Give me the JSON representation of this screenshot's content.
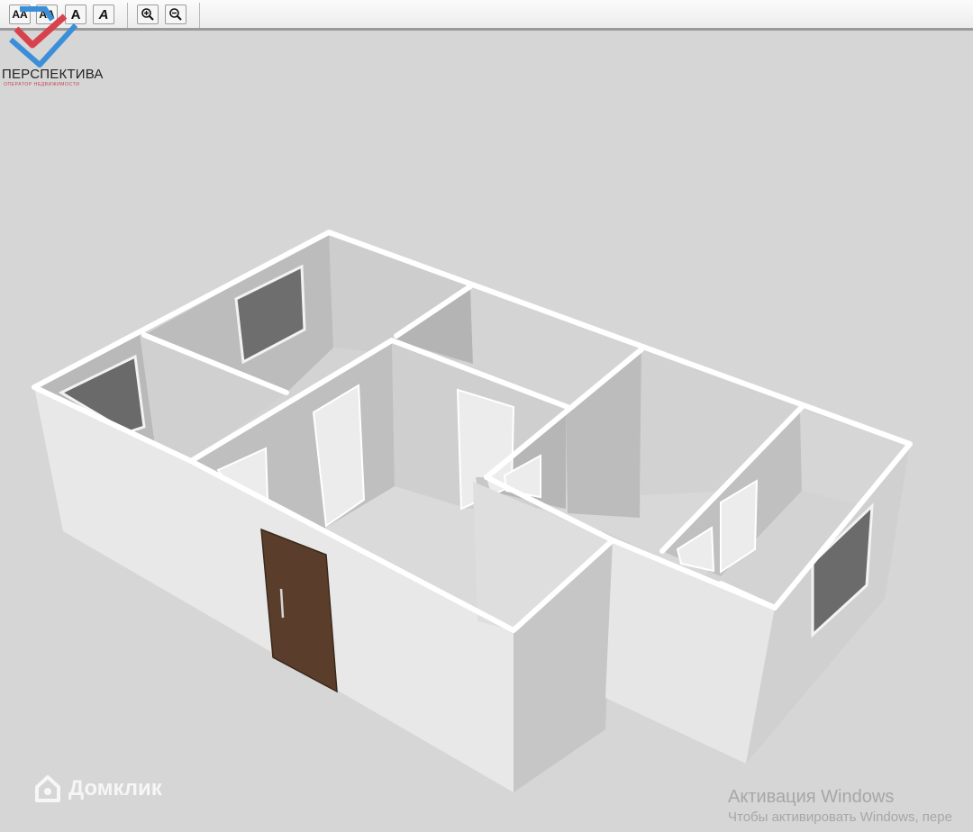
{
  "toolbar": {
    "buttons": [
      {
        "name": "font-increase-button",
        "label": "AA"
      },
      {
        "name": "font-decrease-button",
        "label": "AA"
      },
      {
        "name": "bold-button",
        "label": "A"
      },
      {
        "name": "italic-button",
        "label": "A"
      },
      {
        "name": "zoom-in-button",
        "icon": "zoom-in-icon"
      },
      {
        "name": "zoom-out-button",
        "icon": "zoom-out-icon"
      }
    ]
  },
  "logo": {
    "name": "ПЕРСПЕКТИВА",
    "subtitle": "оператор недвижимости",
    "colors": {
      "primary": "#3b8fd9",
      "accent": "#d8424d"
    }
  },
  "watermark": {
    "text": "Домклик",
    "icon": "house-icon"
  },
  "activation": {
    "title": "Активация Windows",
    "subtitle": "Чтобы активировать Windows, пере"
  },
  "plan": {
    "colors": {
      "background": "#d6d6d6",
      "wall_outer": "#e9e9e9",
      "wall_inner": "#c4c4c4",
      "floor": "#d4d4d4",
      "wall_top": "#ffffff",
      "window": "#717171",
      "entry_door": "#5a3e2b"
    }
  }
}
